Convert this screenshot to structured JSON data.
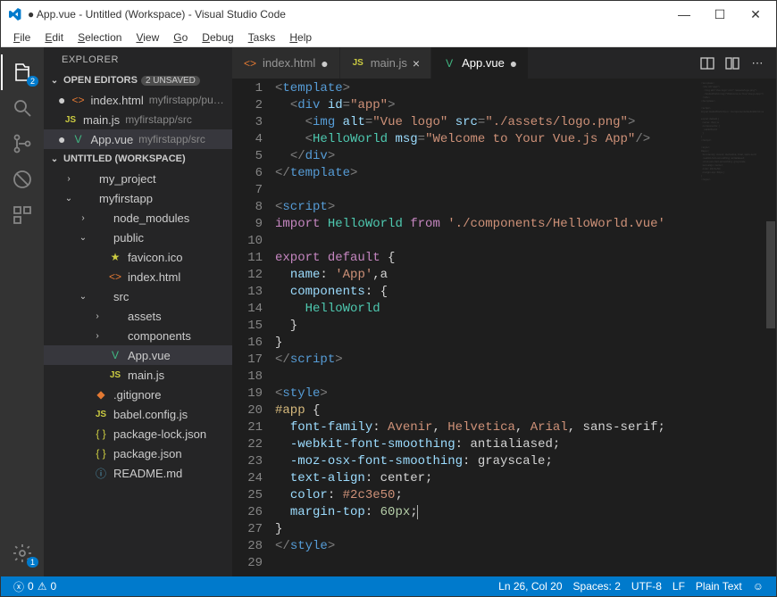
{
  "title": "● App.vue - Untitled (Workspace) - Visual Studio Code",
  "menu": [
    "File",
    "Edit",
    "Selection",
    "View",
    "Go",
    "Debug",
    "Tasks",
    "Help"
  ],
  "activity_badges": {
    "explorer": "2",
    "settings": "1"
  },
  "sidebar": {
    "title": "EXPLORER",
    "open_editors_label": "OPEN EDITORS",
    "unsaved_label": "2 UNSAVED",
    "workspace_label": "UNTITLED (WORKSPACE)",
    "open_editors": [
      {
        "name": "index.html",
        "hint": "myfirstapp/pu…",
        "dirty": true,
        "icon": "html"
      },
      {
        "name": "main.js",
        "hint": "myfirstapp/src",
        "dirty": false,
        "icon": "js"
      },
      {
        "name": "App.vue",
        "hint": "myfirstapp/src",
        "dirty": true,
        "icon": "vue",
        "selected": true
      }
    ],
    "tree": [
      {
        "indent": 1,
        "chev": "›",
        "name": "my_project",
        "icon": ""
      },
      {
        "indent": 1,
        "chev": "⌄",
        "name": "myfirstapp",
        "icon": ""
      },
      {
        "indent": 2,
        "chev": "›",
        "name": "node_modules",
        "icon": ""
      },
      {
        "indent": 2,
        "chev": "⌄",
        "name": "public",
        "icon": ""
      },
      {
        "indent": 3,
        "chev": "",
        "name": "favicon.ico",
        "icon": "star"
      },
      {
        "indent": 3,
        "chev": "",
        "name": "index.html",
        "icon": "html"
      },
      {
        "indent": 2,
        "chev": "⌄",
        "name": "src",
        "icon": ""
      },
      {
        "indent": 3,
        "chev": "›",
        "name": "assets",
        "icon": ""
      },
      {
        "indent": 3,
        "chev": "›",
        "name": "components",
        "icon": ""
      },
      {
        "indent": 3,
        "chev": "",
        "name": "App.vue",
        "icon": "vue",
        "selected": true
      },
      {
        "indent": 3,
        "chev": "",
        "name": "main.js",
        "icon": "js"
      },
      {
        "indent": 2,
        "chev": "",
        "name": ".gitignore",
        "icon": "git"
      },
      {
        "indent": 2,
        "chev": "",
        "name": "babel.config.js",
        "icon": "js"
      },
      {
        "indent": 2,
        "chev": "",
        "name": "package-lock.json",
        "icon": "json"
      },
      {
        "indent": 2,
        "chev": "",
        "name": "package.json",
        "icon": "json"
      },
      {
        "indent": 2,
        "chev": "",
        "name": "README.md",
        "icon": "info"
      }
    ]
  },
  "tabs": [
    {
      "label": "index.html",
      "icon": "html",
      "dirty": true,
      "active": false
    },
    {
      "label": "main.js",
      "icon": "js",
      "dirty": false,
      "active": false
    },
    {
      "label": "App.vue",
      "icon": "vue",
      "dirty": true,
      "active": true
    }
  ],
  "code_lines": [
    [
      [
        "pun",
        "<"
      ],
      [
        "tag",
        "template"
      ],
      [
        "pun",
        ">"
      ]
    ],
    [
      [
        "txt",
        "  "
      ],
      [
        "pun",
        "<"
      ],
      [
        "tag",
        "div"
      ],
      [
        "txt",
        " "
      ],
      [
        "attr",
        "id"
      ],
      [
        "pun",
        "="
      ],
      [
        "str",
        "\"app\""
      ],
      [
        "pun",
        ">"
      ]
    ],
    [
      [
        "txt",
        "    "
      ],
      [
        "pun",
        "<"
      ],
      [
        "tag",
        "img"
      ],
      [
        "txt",
        " "
      ],
      [
        "attr",
        "alt"
      ],
      [
        "pun",
        "="
      ],
      [
        "str",
        "\"Vue logo\""
      ],
      [
        "txt",
        " "
      ],
      [
        "attr",
        "src"
      ],
      [
        "pun",
        "="
      ],
      [
        "str",
        "\"./assets/logo.png\""
      ],
      [
        "pun",
        ">"
      ]
    ],
    [
      [
        "txt",
        "    "
      ],
      [
        "pun",
        "<"
      ],
      [
        "id",
        "HelloWorld"
      ],
      [
        "txt",
        " "
      ],
      [
        "attr",
        "msg"
      ],
      [
        "pun",
        "="
      ],
      [
        "str",
        "\"Welcome to Your Vue.js App\""
      ],
      [
        "pun",
        "/>"
      ]
    ],
    [
      [
        "txt",
        "  "
      ],
      [
        "pun",
        "</"
      ],
      [
        "tag",
        "div"
      ],
      [
        "pun",
        ">"
      ]
    ],
    [
      [
        "pun",
        "</"
      ],
      [
        "tag",
        "template"
      ],
      [
        "pun",
        ">"
      ]
    ],
    [],
    [
      [
        "pun",
        "<"
      ],
      [
        "tag",
        "script"
      ],
      [
        "pun",
        ">"
      ]
    ],
    [
      [
        "kw",
        "import"
      ],
      [
        "txt",
        " "
      ],
      [
        "id",
        "HelloWorld"
      ],
      [
        "txt",
        " "
      ],
      [
        "kw",
        "from"
      ],
      [
        "txt",
        " "
      ],
      [
        "str",
        "'./components/HelloWorld.vue'"
      ]
    ],
    [],
    [
      [
        "kw",
        "export"
      ],
      [
        "txt",
        " "
      ],
      [
        "kw",
        "default"
      ],
      [
        "txt",
        " {"
      ]
    ],
    [
      [
        "txt",
        "  "
      ],
      [
        "attr",
        "name"
      ],
      [
        "txt",
        ": "
      ],
      [
        "str",
        "'App'"
      ],
      [
        "txt",
        ",a"
      ]
    ],
    [
      [
        "txt",
        "  "
      ],
      [
        "attr",
        "components"
      ],
      [
        "txt",
        ": {"
      ]
    ],
    [
      [
        "txt",
        "    "
      ],
      [
        "id",
        "HelloWorld"
      ]
    ],
    [
      [
        "txt",
        "  }"
      ]
    ],
    [
      [
        "txt",
        "}"
      ]
    ],
    [
      [
        "pun",
        "</"
      ],
      [
        "tag",
        "script"
      ],
      [
        "pun",
        ">"
      ]
    ],
    [],
    [
      [
        "pun",
        "<"
      ],
      [
        "tag",
        "style"
      ],
      [
        "pun",
        ">"
      ]
    ],
    [
      [
        "sel",
        "#app"
      ],
      [
        "txt",
        " {"
      ]
    ],
    [
      [
        "txt",
        "  "
      ],
      [
        "attr",
        "font-family"
      ],
      [
        "txt",
        ": "
      ],
      [
        "str",
        "Avenir"
      ],
      [
        "txt",
        ", "
      ],
      [
        "str",
        "Helvetica"
      ],
      [
        "txt",
        ", "
      ],
      [
        "str",
        "Arial"
      ],
      [
        "txt",
        ", sans-serif;"
      ]
    ],
    [
      [
        "txt",
        "  "
      ],
      [
        "attr",
        "-webkit-font-smoothing"
      ],
      [
        "txt",
        ": antialiased;"
      ]
    ],
    [
      [
        "txt",
        "  "
      ],
      [
        "attr",
        "-moz-osx-font-smoothing"
      ],
      [
        "txt",
        ": grayscale;"
      ]
    ],
    [
      [
        "txt",
        "  "
      ],
      [
        "attr",
        "text-align"
      ],
      [
        "txt",
        ": center;"
      ]
    ],
    [
      [
        "txt",
        "  "
      ],
      [
        "attr",
        "color"
      ],
      [
        "txt",
        ": "
      ],
      [
        "str",
        "#2c3e50"
      ],
      [
        "txt",
        ";"
      ]
    ],
    [
      [
        "txt",
        "  "
      ],
      [
        "attr",
        "margin-top"
      ],
      [
        "txt",
        ": "
      ],
      [
        "num",
        "60px"
      ],
      [
        "txt",
        ";"
      ],
      [
        "cursor",
        "|"
      ]
    ],
    [
      [
        "txt",
        "}"
      ]
    ],
    [
      [
        "pun",
        "</"
      ],
      [
        "tag",
        "style"
      ],
      [
        "pun",
        ">"
      ]
    ],
    []
  ],
  "status": {
    "errors": "0",
    "warnings": "0",
    "pos": "Ln 26, Col 20",
    "spaces": "Spaces: 2",
    "enc": "UTF-8",
    "eol": "LF",
    "lang": "Plain Text"
  }
}
